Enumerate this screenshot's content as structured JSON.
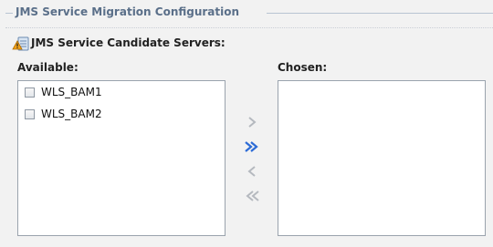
{
  "section": {
    "legend": "JMS Service Migration Configuration",
    "candidate_label": "JMS Service Candidate Servers:"
  },
  "available": {
    "label": "Available:",
    "items": [
      {
        "label": "WLS_BAM1",
        "checked": false
      },
      {
        "label": "WLS_BAM2",
        "checked": false
      }
    ]
  },
  "chosen": {
    "label": "Chosen:",
    "items": []
  },
  "buttons": {
    "move_right_icon": "chevron-right-icon",
    "move_all_right_icon": "double-chevron-right-icon",
    "move_left_icon": "chevron-left-icon",
    "move_all_left_icon": "double-chevron-left-icon"
  },
  "colors": {
    "legend_text": "#5a6f89",
    "active_arrow": "#2c6bd6",
    "disabled_arrow": "#b5b9bf",
    "warning_icon": "#f0a21a"
  }
}
